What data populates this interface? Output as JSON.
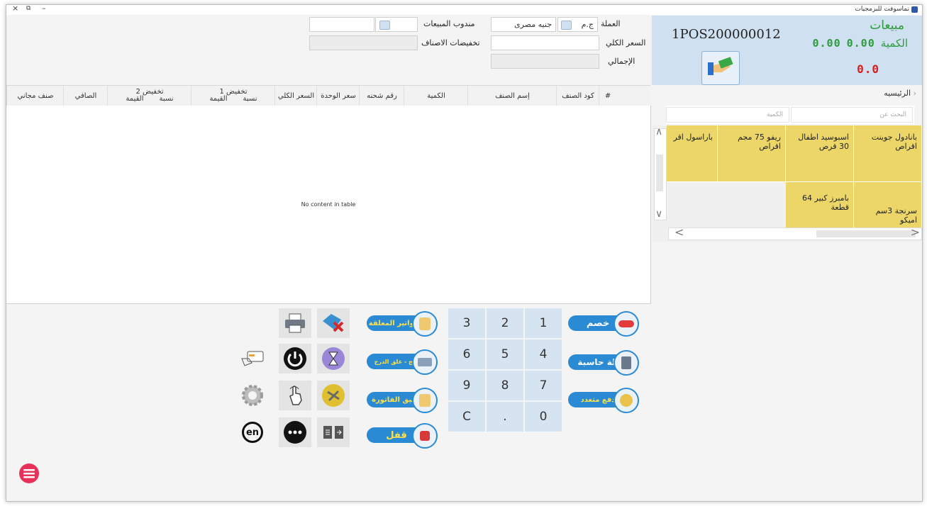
{
  "window": {
    "title": "نماسوفت للبرمجيات",
    "controls": {
      "close": "×",
      "restore": "⧉",
      "minimize": "–"
    }
  },
  "form": {
    "currency_label": "العملة",
    "currency_code": "ج.م",
    "currency_name": "جنيه مصرى",
    "total_price_label": "السعر الكلي",
    "total_label": "الإجمالي",
    "salesman_label": "مندوب المبيعات",
    "item_discounts_label": "تخفيضات الاصناف"
  },
  "summary": {
    "title": "مبيعات",
    "qty_label": "الكمية",
    "qty_value": "0.00",
    "amount_value": "0.00",
    "total_value": "0.0",
    "invoice_no": "1POS200000012"
  },
  "table": {
    "headers": {
      "num": "#",
      "code": "كود الصنف",
      "name": "إسم الصنف",
      "qty": "الكمية",
      "batch": "رقم شحنه",
      "unit_price": "سعر الوحدة",
      "total_price": "السعر الكلي",
      "disc1": "تخفيض 1",
      "disc1_pct": "نسبة",
      "disc1_val": "القيمة",
      "disc2": "تخفيض 2",
      "disc2_pct": "نسبة",
      "disc2_val": "القيمة",
      "net": "الصافي",
      "free": "صنف مجاني"
    },
    "empty_text": "No content in table"
  },
  "catalog": {
    "breadcrumb": "الرئيسيه",
    "search_placeholder": "البحث عن",
    "qty_placeholder": "الكمية",
    "items": [
      "بانادول جوينت اقراص",
      "اسبوسيد اطفال 30 قرص",
      "ريفو 75 مجم اقراص",
      "باراسول اقر",
      "سرنجة 3سم اميكو",
      "بامبرز كبير 64 قطعة"
    ]
  },
  "keypad": [
    "3",
    "2",
    "1",
    "6",
    "5",
    "4",
    "9",
    "8",
    "7",
    "C",
    ".",
    "0"
  ],
  "actions": {
    "discount": "خصم",
    "calculator": "الة حاسبة",
    "multi_pay": "دفع متعدد",
    "held_invoices": "الفواتير المعلقة",
    "open_close_drawer": "فتح - غلق الدرج",
    "hold_invoice": "تعليق الفاتورة",
    "lock": "قفل",
    "lang": "en"
  },
  "colors": {
    "accent": "#2b8ad4",
    "panel": "#cfe0f0",
    "tile": "#ecd667",
    "green": "#2e9a3e",
    "red": "#d42020",
    "menu": "#e8315a"
  }
}
